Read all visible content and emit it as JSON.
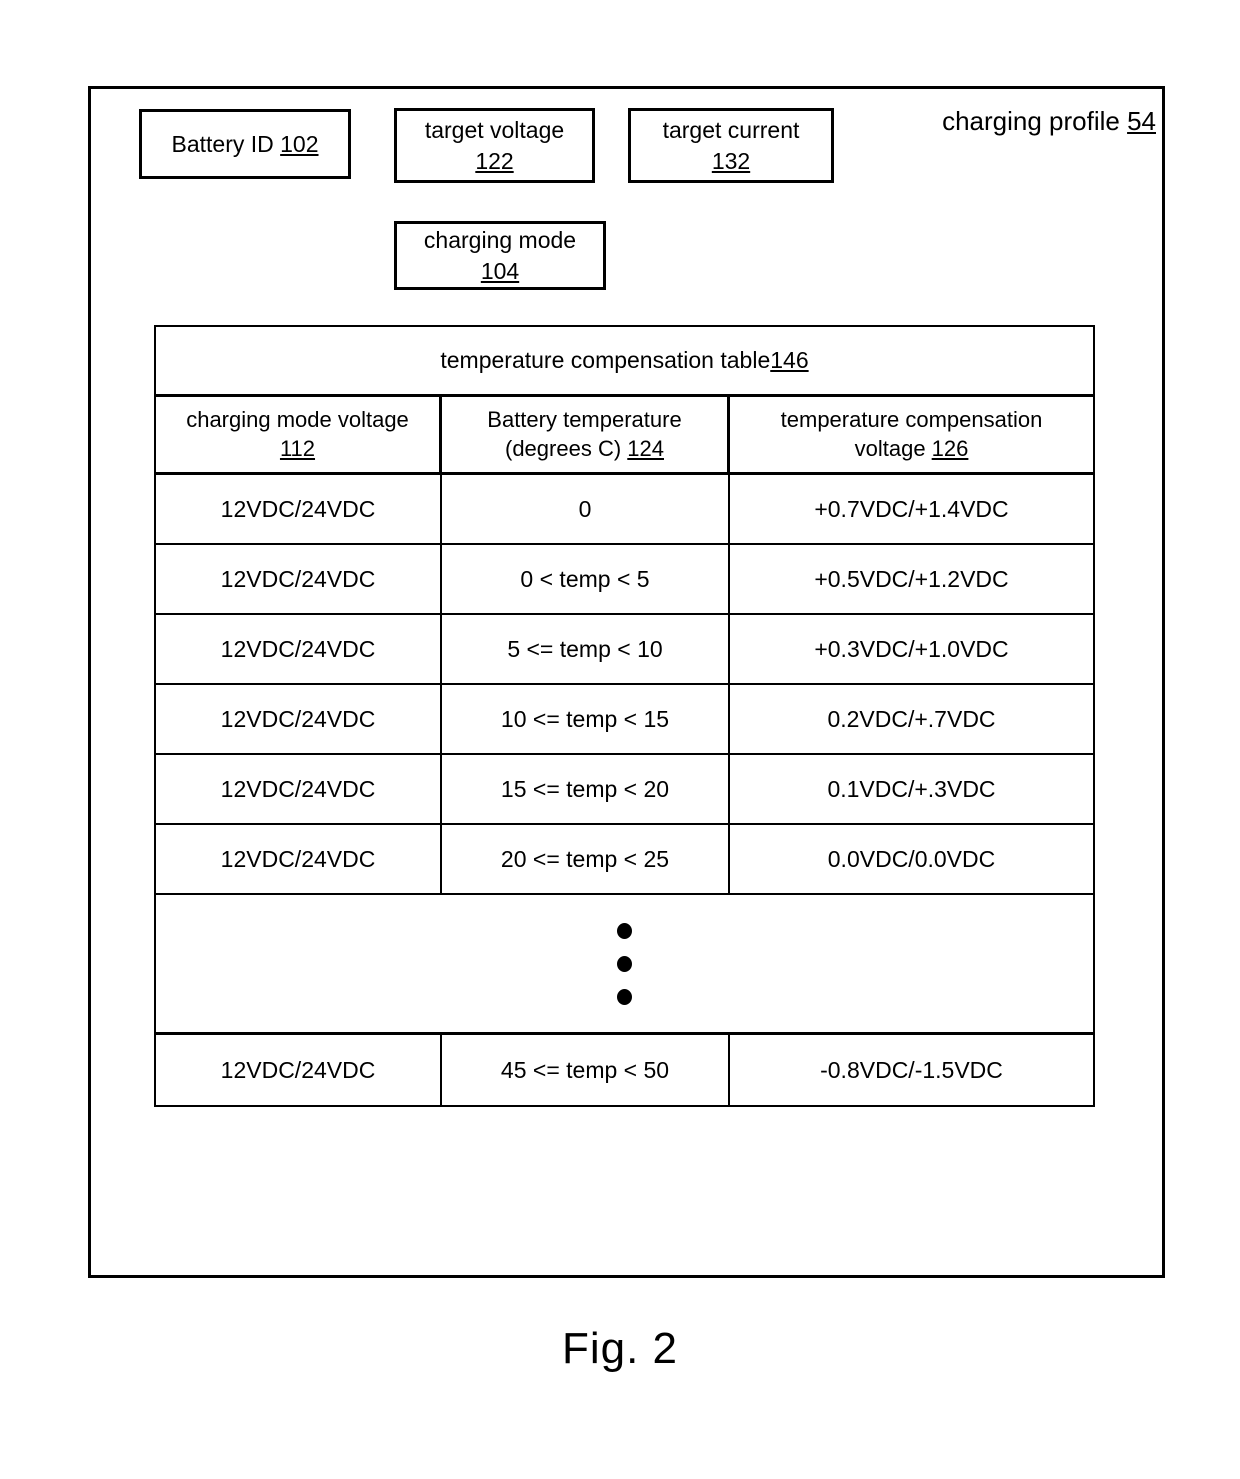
{
  "figure": {
    "caption": "Fig. 2",
    "profile_label_text": "charging profile ",
    "profile_label_ref": "54"
  },
  "boxes": {
    "battery_id": {
      "label": "Battery ID ",
      "ref": "102"
    },
    "target_voltage": {
      "label": "target voltage",
      "ref": "122"
    },
    "target_current": {
      "label": "target current",
      "ref": "132"
    },
    "charging_mode": {
      "label": "charging mode",
      "ref": "104"
    }
  },
  "table": {
    "title": "temperature compensation table ",
    "title_ref": "146",
    "columns": [
      {
        "label": "charging mode voltage",
        "ref": "112"
      },
      {
        "label": "Battery temperature (degrees C) ",
        "line1": "Battery temperature",
        "line2": "(degrees C) ",
        "ref": "124"
      },
      {
        "label": "temperature compensation voltage ",
        "line1": "temperature compensation",
        "line2": "voltage ",
        "ref": "126"
      }
    ],
    "rows": [
      {
        "charging_mode_voltage": "12VDC/24VDC",
        "battery_temperature": "0",
        "temperature_compensation_voltage": "+0.7VDC/+1.4VDC"
      },
      {
        "charging_mode_voltage": "12VDC/24VDC",
        "battery_temperature": "0 < temp < 5",
        "temperature_compensation_voltage": "+0.5VDC/+1.2VDC"
      },
      {
        "charging_mode_voltage": "12VDC/24VDC",
        "battery_temperature": "5 <= temp < 10",
        "temperature_compensation_voltage": "+0.3VDC/+1.0VDC"
      },
      {
        "charging_mode_voltage": "12VDC/24VDC",
        "battery_temperature": "10 <= temp < 15",
        "temperature_compensation_voltage": "0.2VDC/+.7VDC"
      },
      {
        "charging_mode_voltage": "12VDC/24VDC",
        "battery_temperature": "15 <= temp < 20",
        "temperature_compensation_voltage": "0.1VDC/+.3VDC"
      },
      {
        "charging_mode_voltage": "12VDC/24VDC",
        "battery_temperature": "20 <= temp < 25",
        "temperature_compensation_voltage": "0.0VDC/0.0VDC"
      }
    ],
    "continuation": "vertical-ellipsis",
    "last_row": {
      "charging_mode_voltage": "12VDC/24VDC",
      "battery_temperature": "45 <= temp < 50",
      "temperature_compensation_voltage": "-0.8VDC/-1.5VDC"
    }
  }
}
